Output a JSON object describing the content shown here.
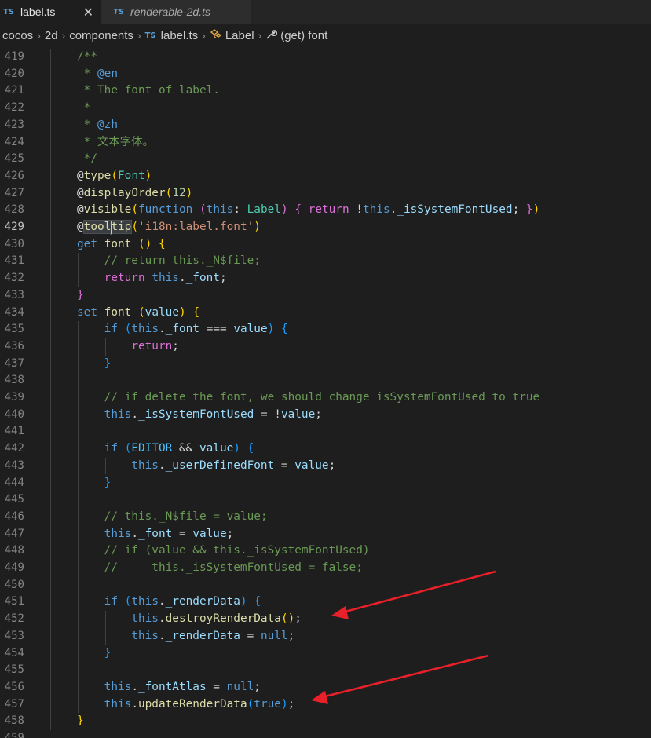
{
  "tabs": [
    {
      "badge": "TS",
      "label": "label.ts",
      "close": "✕"
    },
    {
      "badge": "TS",
      "label": "renderable-2d.ts"
    }
  ],
  "breadcrumb": {
    "items": [
      "cocos",
      "2d",
      "components"
    ],
    "file_badge": "TS",
    "file": "label.ts",
    "class_symbol": "Label",
    "method_symbol": "(get) font",
    "separator": "›"
  },
  "editor": {
    "current_line": "429",
    "lines": [
      {
        "n": "419",
        "t": [
          [
            "cm",
            "/**"
          ]
        ]
      },
      {
        "n": "420",
        "t": [
          [
            "cm",
            " * "
          ],
          [
            "tag",
            "@en"
          ]
        ]
      },
      {
        "n": "421",
        "t": [
          [
            "cm",
            " * The font of label."
          ]
        ]
      },
      {
        "n": "422",
        "t": [
          [
            "cm",
            " *"
          ]
        ]
      },
      {
        "n": "423",
        "t": [
          [
            "cm",
            " * "
          ],
          [
            "tag",
            "@zh"
          ]
        ]
      },
      {
        "n": "424",
        "t": [
          [
            "cm",
            " * 文本字体。"
          ]
        ]
      },
      {
        "n": "425",
        "t": [
          [
            "cm",
            " */"
          ]
        ]
      },
      {
        "n": "426",
        "t": [
          [
            "pl",
            "@"
          ],
          [
            "fn",
            "type"
          ],
          [
            "br1",
            "("
          ],
          [
            "ty",
            "Font"
          ],
          [
            "br1",
            ")"
          ]
        ]
      },
      {
        "n": "427",
        "t": [
          [
            "pl",
            "@"
          ],
          [
            "fn",
            "displayOrder"
          ],
          [
            "br1",
            "("
          ],
          [
            "nm",
            "12"
          ],
          [
            "br1",
            ")"
          ]
        ]
      },
      {
        "n": "428",
        "t": [
          [
            "pl",
            "@"
          ],
          [
            "fn",
            "visible"
          ],
          [
            "br1",
            "("
          ],
          [
            "kw",
            "function"
          ],
          [
            "pl",
            " "
          ],
          [
            "br2",
            "("
          ],
          [
            "kw",
            "this"
          ],
          [
            "pl",
            ": "
          ],
          [
            "ty",
            "Label"
          ],
          [
            "br2",
            ")"
          ],
          [
            "pl",
            " "
          ],
          [
            "br2",
            "{"
          ],
          [
            "pl",
            " "
          ],
          [
            "br2",
            "return"
          ],
          [
            "pl",
            " !"
          ],
          [
            "kw",
            "this"
          ],
          [
            "pl",
            "."
          ],
          [
            "vr",
            "_isSystemFontUsed"
          ],
          [
            "pl",
            "; "
          ],
          [
            "br2",
            "}"
          ],
          [
            "br1",
            ")"
          ]
        ]
      },
      {
        "n": "429",
        "t": [
          [
            "sel",
            "@"
          ],
          [
            "selfn",
            "tool"
          ],
          [
            "cursor",
            ""
          ],
          [
            "selfn",
            "tip"
          ],
          [
            "br1",
            "("
          ],
          [
            "st",
            "'i18n:label.font'"
          ],
          [
            "br1",
            ")"
          ]
        ]
      },
      {
        "n": "430",
        "t": [
          [
            "kw",
            "get"
          ],
          [
            "pl",
            " "
          ],
          [
            "fn",
            "font"
          ],
          [
            "pl",
            " "
          ],
          [
            "br1",
            "()"
          ],
          [
            "pl",
            " "
          ],
          [
            "br1",
            "{"
          ]
        ]
      },
      {
        "n": "431",
        "t": [
          [
            "pl",
            "    "
          ],
          [
            "cm",
            "// return this._N$file;"
          ]
        ]
      },
      {
        "n": "432",
        "t": [
          [
            "pl",
            "    "
          ],
          [
            "br2",
            "return"
          ],
          [
            "pl",
            " "
          ],
          [
            "kw",
            "this"
          ],
          [
            "pl",
            "."
          ],
          [
            "vr",
            "_font"
          ],
          [
            "pl",
            ";"
          ]
        ]
      },
      {
        "n": "433",
        "t": [
          [
            "br2",
            "}"
          ]
        ]
      },
      {
        "n": "434",
        "t": [
          [
            "kw",
            "set"
          ],
          [
            "pl",
            " "
          ],
          [
            "fn",
            "font"
          ],
          [
            "pl",
            " "
          ],
          [
            "br1",
            "("
          ],
          [
            "vr",
            "value"
          ],
          [
            "br1",
            ")"
          ],
          [
            "pl",
            " "
          ],
          [
            "br1",
            "{"
          ]
        ]
      },
      {
        "n": "435",
        "t": [
          [
            "pl",
            "    "
          ],
          [
            "kw",
            "if"
          ],
          [
            "pl",
            " "
          ],
          [
            "br3",
            "("
          ],
          [
            "kw",
            "this"
          ],
          [
            "pl",
            "."
          ],
          [
            "vr",
            "_font"
          ],
          [
            "pl",
            " === "
          ],
          [
            "vr",
            "value"
          ],
          [
            "br3",
            ")"
          ],
          [
            "pl",
            " "
          ],
          [
            "br3",
            "{"
          ]
        ]
      },
      {
        "n": "436",
        "t": [
          [
            "pl",
            "        "
          ],
          [
            "br2",
            "return"
          ],
          [
            "pl",
            ";"
          ]
        ]
      },
      {
        "n": "437",
        "t": [
          [
            "pl",
            "    "
          ],
          [
            "br3",
            "}"
          ]
        ]
      },
      {
        "n": "438",
        "t": []
      },
      {
        "n": "439",
        "t": [
          [
            "pl",
            "    "
          ],
          [
            "cm",
            "// if delete the font, we should change isSystemFontUsed to true"
          ]
        ]
      },
      {
        "n": "440",
        "t": [
          [
            "pl",
            "    "
          ],
          [
            "kw",
            "this"
          ],
          [
            "pl",
            "."
          ],
          [
            "vr",
            "_isSystemFontUsed"
          ],
          [
            "pl",
            " = !"
          ],
          [
            "vr",
            "value"
          ],
          [
            "pl",
            ";"
          ]
        ]
      },
      {
        "n": "441",
        "t": []
      },
      {
        "n": "442",
        "t": [
          [
            "pl",
            "    "
          ],
          [
            "kw",
            "if"
          ],
          [
            "pl",
            " "
          ],
          [
            "br3",
            "("
          ],
          [
            "cn",
            "EDITOR"
          ],
          [
            "pl",
            " && "
          ],
          [
            "vr",
            "value"
          ],
          [
            "br3",
            ")"
          ],
          [
            "pl",
            " "
          ],
          [
            "br3",
            "{"
          ]
        ]
      },
      {
        "n": "443",
        "t": [
          [
            "pl",
            "        "
          ],
          [
            "kw",
            "this"
          ],
          [
            "pl",
            "."
          ],
          [
            "vr",
            "_userDefinedFont"
          ],
          [
            "pl",
            " = "
          ],
          [
            "vr",
            "value"
          ],
          [
            "pl",
            ";"
          ]
        ]
      },
      {
        "n": "444",
        "t": [
          [
            "pl",
            "    "
          ],
          [
            "br3",
            "}"
          ]
        ]
      },
      {
        "n": "445",
        "t": []
      },
      {
        "n": "446",
        "t": [
          [
            "pl",
            "    "
          ],
          [
            "cm",
            "// this._N$file = value;"
          ]
        ]
      },
      {
        "n": "447",
        "t": [
          [
            "pl",
            "    "
          ],
          [
            "kw",
            "this"
          ],
          [
            "pl",
            "."
          ],
          [
            "vr",
            "_font"
          ],
          [
            "pl",
            " = "
          ],
          [
            "vr",
            "value"
          ],
          [
            "pl",
            ";"
          ]
        ]
      },
      {
        "n": "448",
        "t": [
          [
            "pl",
            "    "
          ],
          [
            "cm",
            "// if (value && this._isSystemFontUsed)"
          ]
        ]
      },
      {
        "n": "449",
        "t": [
          [
            "pl",
            "    "
          ],
          [
            "cm",
            "//     this._isSystemFontUsed = false;"
          ]
        ]
      },
      {
        "n": "450",
        "t": []
      },
      {
        "n": "451",
        "t": [
          [
            "pl",
            "    "
          ],
          [
            "kw",
            "if"
          ],
          [
            "pl",
            " "
          ],
          [
            "br3",
            "("
          ],
          [
            "kw",
            "this"
          ],
          [
            "pl",
            "."
          ],
          [
            "vr",
            "_renderData"
          ],
          [
            "br3",
            ")"
          ],
          [
            "pl",
            " "
          ],
          [
            "br3",
            "{"
          ]
        ]
      },
      {
        "n": "452",
        "t": [
          [
            "pl",
            "        "
          ],
          [
            "kw",
            "this"
          ],
          [
            "pl",
            "."
          ],
          [
            "fn",
            "destroyRenderData"
          ],
          [
            "br1",
            "()"
          ],
          [
            "pl",
            ";"
          ]
        ]
      },
      {
        "n": "453",
        "t": [
          [
            "pl",
            "        "
          ],
          [
            "kw",
            "this"
          ],
          [
            "pl",
            "."
          ],
          [
            "vr",
            "_renderData"
          ],
          [
            "pl",
            " = "
          ],
          [
            "kw",
            "null"
          ],
          [
            "pl",
            ";"
          ]
        ]
      },
      {
        "n": "454",
        "t": [
          [
            "pl",
            "    "
          ],
          [
            "br3",
            "}"
          ]
        ]
      },
      {
        "n": "455",
        "t": []
      },
      {
        "n": "456",
        "t": [
          [
            "pl",
            "    "
          ],
          [
            "kw",
            "this"
          ],
          [
            "pl",
            "."
          ],
          [
            "vr",
            "_fontAtlas"
          ],
          [
            "pl",
            " = "
          ],
          [
            "kw",
            "null"
          ],
          [
            "pl",
            ";"
          ]
        ]
      },
      {
        "n": "457",
        "t": [
          [
            "pl",
            "    "
          ],
          [
            "kw",
            "this"
          ],
          [
            "pl",
            "."
          ],
          [
            "fn",
            "updateRenderData"
          ],
          [
            "br3",
            "("
          ],
          [
            "kw",
            "true"
          ],
          [
            "br3",
            ")"
          ],
          [
            "pl",
            ";"
          ]
        ]
      },
      {
        "n": "458",
        "t": [
          [
            "br1",
            "}"
          ]
        ]
      },
      {
        "n": "459",
        "t": []
      }
    ]
  },
  "annotations": {
    "arrow_color": "#e8202a",
    "arrows": [
      "arrow to line 452",
      "arrow to line 457"
    ]
  }
}
